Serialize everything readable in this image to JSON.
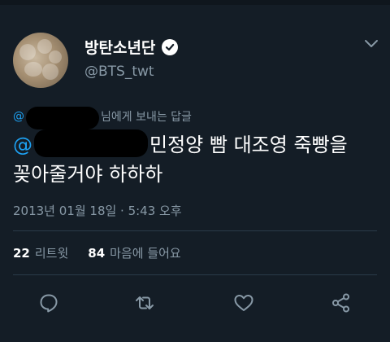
{
  "author": {
    "display_name": "방탄소년단",
    "handle": "@BTS_twt",
    "verified": true
  },
  "reply_to": {
    "prefix": "@",
    "suffix": "님에게 보내는 답글"
  },
  "tweet": {
    "mention_prefix": "@",
    "line1_rest": "민정양 빰 대조영 죽빵을",
    "line2": "꽂아줄거야 하하하"
  },
  "timestamp": "2013년 01월 18일 · 5:43 오후",
  "stats": {
    "retweets_count": "22",
    "retweets_label": "리트윗",
    "likes_count": "84",
    "likes_label": "마음에 들어요"
  },
  "icons": {
    "reply": "reply-icon",
    "retweet": "retweet-icon",
    "like": "heart-icon",
    "share": "share-icon",
    "menu": "chevron-down-icon",
    "verified": "verified-badge-icon"
  },
  "colors": {
    "background": "#141d26",
    "link": "#1da1f2",
    "secondary_text": "#8899a6",
    "primary_text": "#ffffff",
    "icon": "#8899a6"
  }
}
